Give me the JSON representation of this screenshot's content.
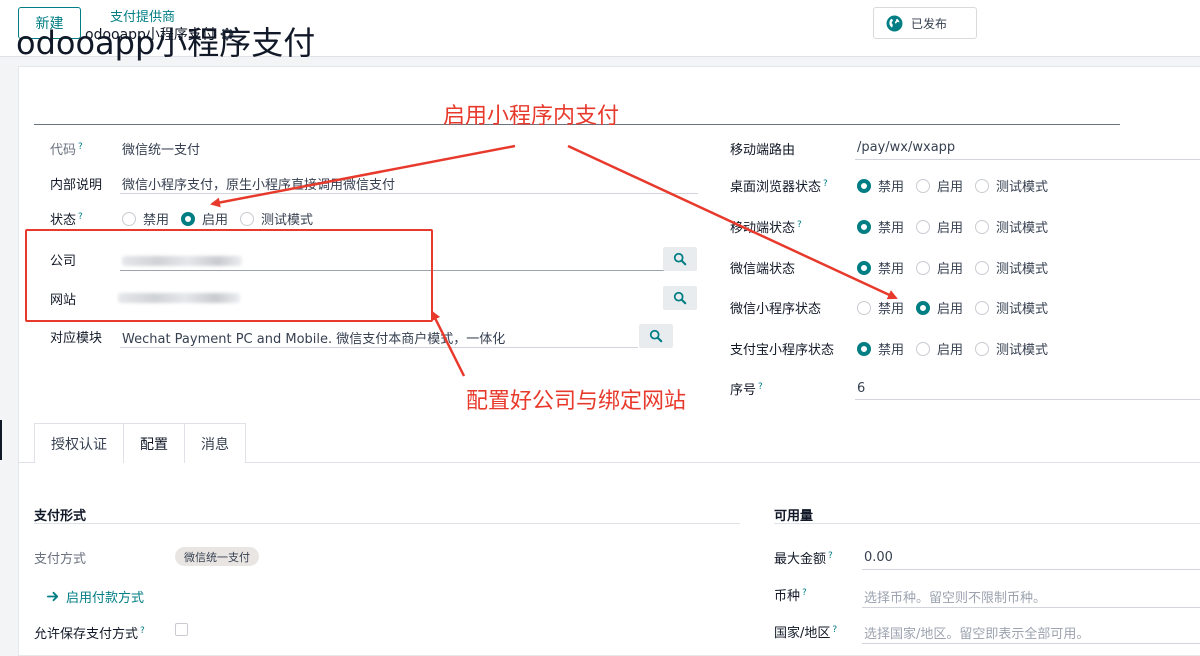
{
  "control_panel": {
    "new_button": "新建",
    "breadcrumb_parent": "支付提供商",
    "breadcrumb_current": "odooapp小程序支付",
    "published_button": "已发布"
  },
  "form": {
    "title": "odooapp小程序支付",
    "left": {
      "code_label": "代码",
      "code_value": "微信统一支付",
      "internal_label": "内部说明",
      "internal_value": "微信小程序支付，原生小程序直接调用微信支付",
      "state_label": "状态",
      "state_options": [
        "禁用",
        "启用",
        "测试模式"
      ],
      "state_selected": 1,
      "company_label": "公司",
      "website_label": "网站",
      "module_label": "对应模块",
      "module_value": "Wechat Payment PC and Mobile. 微信支付本商户模式，一体化"
    },
    "right": {
      "mobile_route_label": "移动端路由",
      "mobile_route_value": "/pay/wx/wxapp",
      "rows": [
        {
          "label": "桌面浏览器状态",
          "selected": 0
        },
        {
          "label": "移动端状态",
          "selected": 0
        },
        {
          "label": "微信端状态",
          "selected": 0
        },
        {
          "label": "微信小程序状态",
          "selected": 1
        },
        {
          "label": "支付宝小程序状态",
          "selected": 0
        }
      ],
      "options": [
        "禁用",
        "启用",
        "测试模式"
      ],
      "sequence_label": "序号",
      "sequence_value": "6"
    }
  },
  "annotations": {
    "top": "启用小程序内支付",
    "bottom": "配置好公司与绑定网站"
  },
  "tabs": [
    "授权认证",
    "配置",
    "消息"
  ],
  "tabs_active": 1,
  "config": {
    "pay_section_title": "支付形式",
    "pay_method_label": "支付方式",
    "pay_method_badge": "微信统一支付",
    "enable_link": "启用付款方式",
    "save_label": "允许保存支付方式",
    "avail_section_title": "可用量",
    "max_amount_label": "最大金额",
    "max_amount_value": "0.00",
    "currency_label": "币种",
    "currency_placeholder": "选择币种。留空则不限制币种。",
    "country_label": "国家/地区",
    "country_placeholder": "选择国家/地区。留空即表示全部可用。"
  },
  "colors": {
    "brand": "#017e84",
    "annotation": "#e83a2c"
  }
}
